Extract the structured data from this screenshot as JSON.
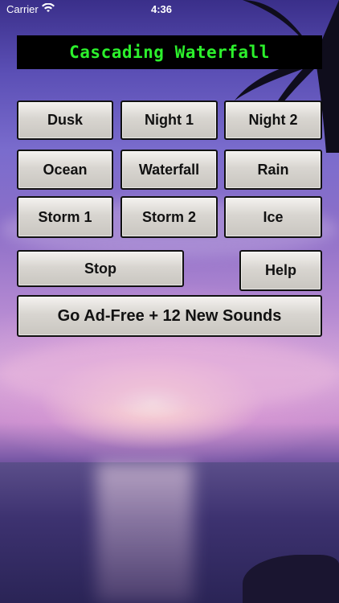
{
  "status_bar": {
    "carrier": "Carrier",
    "time": "4:36"
  },
  "app": {
    "title": "Cascading Waterfall"
  },
  "sounds": [
    "Dusk",
    "Night 1",
    "Night 2",
    "Ocean",
    "Waterfall",
    "Rain",
    "Storm 1",
    "Storm 2",
    "Ice"
  ],
  "controls": {
    "stop": "Stop",
    "help": "Help",
    "upgrade": "Go Ad-Free + 12 New Sounds"
  },
  "icons": {
    "wifi": "wifi-icon"
  }
}
